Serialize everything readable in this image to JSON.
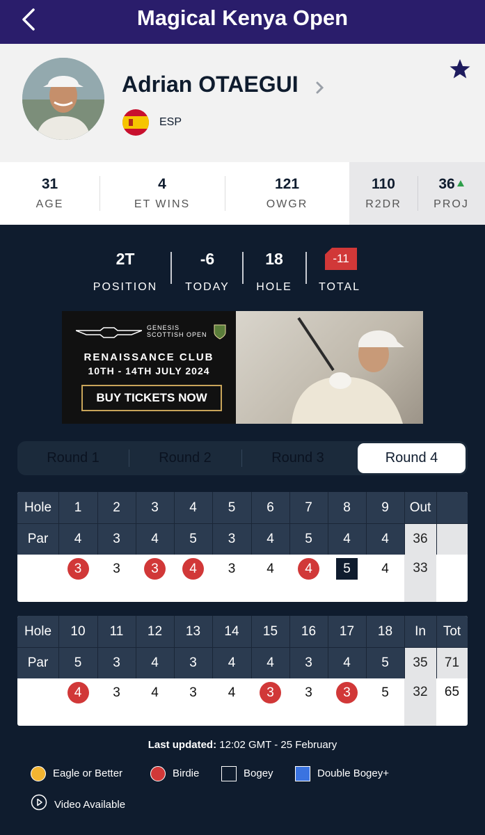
{
  "header": {
    "title": "Magical Kenya Open"
  },
  "player": {
    "name": "Adrian OTAEGUI",
    "nationality": "ESP"
  },
  "stats": [
    {
      "value": "31",
      "label": "AGE"
    },
    {
      "value": "4",
      "label": "ET WINS"
    },
    {
      "value": "121",
      "label": "OWGR"
    },
    {
      "value": "110",
      "label": "R2DR"
    },
    {
      "value": "36",
      "label": "PROJ"
    }
  ],
  "summary": {
    "position": {
      "value": "2T",
      "label": "POSITION"
    },
    "today": {
      "value": "-6",
      "label": "TODAY"
    },
    "hole": {
      "value": "18",
      "label": "HOLE"
    },
    "total": {
      "value": "-11",
      "label": "TOTAL"
    }
  },
  "ad": {
    "brand_line1": "GENESIS",
    "brand_line2": "SCOTTISH OPEN",
    "venue": "RENAISSANCE CLUB",
    "dates": "10TH - 14TH JULY 2024",
    "cta": "BUY TICKETS NOW"
  },
  "tabs": [
    "Round 1",
    "Round 2",
    "Round 3",
    "Round 4"
  ],
  "active_tab": "Round 4",
  "scorecard": {
    "hole_label": "Hole",
    "par_label": "Par",
    "front": {
      "holes": [
        "1",
        "2",
        "3",
        "4",
        "5",
        "6",
        "7",
        "8",
        "9"
      ],
      "pars": [
        "4",
        "3",
        "4",
        "5",
        "3",
        "4",
        "5",
        "4",
        "4"
      ],
      "scores": [
        {
          "s": "3",
          "type": "birdie"
        },
        {
          "s": "3",
          "type": "par"
        },
        {
          "s": "3",
          "type": "birdie"
        },
        {
          "s": "4",
          "type": "birdie"
        },
        {
          "s": "3",
          "type": "par"
        },
        {
          "s": "4",
          "type": "par"
        },
        {
          "s": "4",
          "type": "birdie"
        },
        {
          "s": "5",
          "type": "bogey"
        },
        {
          "s": "4",
          "type": "par"
        }
      ],
      "sub_label": "Out",
      "sub_par": "36",
      "sub_score": "33",
      "tot_label": "",
      "tot_par": "",
      "tot_score": ""
    },
    "back": {
      "holes": [
        "10",
        "11",
        "12",
        "13",
        "14",
        "15",
        "16",
        "17",
        "18"
      ],
      "pars": [
        "5",
        "3",
        "4",
        "3",
        "4",
        "4",
        "3",
        "4",
        "5"
      ],
      "scores": [
        {
          "s": "4",
          "type": "birdie"
        },
        {
          "s": "3",
          "type": "par"
        },
        {
          "s": "4",
          "type": "par"
        },
        {
          "s": "3",
          "type": "par"
        },
        {
          "s": "4",
          "type": "par"
        },
        {
          "s": "3",
          "type": "birdie"
        },
        {
          "s": "3",
          "type": "par"
        },
        {
          "s": "3",
          "type": "birdie"
        },
        {
          "s": "5",
          "type": "par"
        }
      ],
      "sub_label": "In",
      "sub_par": "35",
      "sub_score": "32",
      "tot_label": "Tot",
      "tot_par": "71",
      "tot_score": "65"
    }
  },
  "footer": {
    "updated_label": "Last updated:",
    "updated_value": "12:02 GMT - 25 February",
    "legend": [
      {
        "label": "Eagle or Better",
        "shape": "circle",
        "color": "#f2b431"
      },
      {
        "label": "Birdie",
        "shape": "circle",
        "color": "#d13838"
      },
      {
        "label": "Bogey",
        "shape": "square",
        "color": "#0f1c2e"
      },
      {
        "label": "Double Bogey+",
        "shape": "square",
        "color": "#3a73e0"
      }
    ],
    "video_label": "Video Available"
  }
}
